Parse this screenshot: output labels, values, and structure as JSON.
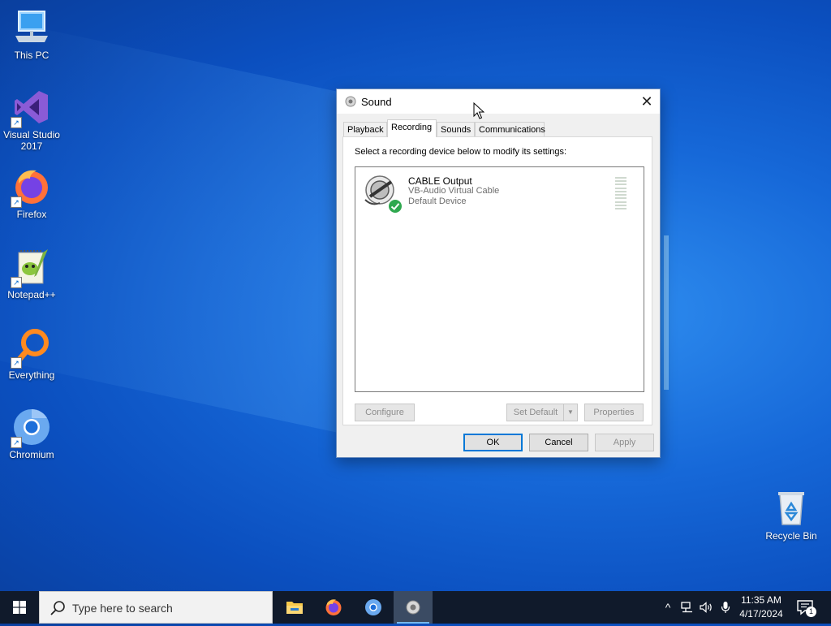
{
  "desktop": {
    "icons": [
      {
        "label": "This PC",
        "icon": "computer-icon"
      },
      {
        "label": "Visual Studio 2017",
        "icon": "visual-studio-icon"
      },
      {
        "label": "Firefox",
        "icon": "firefox-icon"
      },
      {
        "label": "Notepad++",
        "icon": "notepad-plus-plus-icon"
      },
      {
        "label": "Everything",
        "icon": "everything-search-icon"
      },
      {
        "label": "Chromium",
        "icon": "chromium-icon"
      },
      {
        "label": "Recycle Bin",
        "icon": "recycle-bin-icon"
      }
    ]
  },
  "dialog": {
    "title": "Sound",
    "close_glyph": "✕",
    "tabs": [
      {
        "label": "Playback",
        "active": false
      },
      {
        "label": "Recording",
        "active": true
      },
      {
        "label": "Sounds",
        "active": false
      },
      {
        "label": "Communications",
        "active": false
      }
    ],
    "instruction": "Select a recording device below to modify its settings:",
    "devices": [
      {
        "name": "CABLE Output",
        "description": "VB-Audio Virtual Cable",
        "status": "Default Device",
        "icon": "microphone-cable-icon",
        "badge": "default-check-icon"
      }
    ],
    "buttons": {
      "configure": "Configure",
      "set_default": "Set Default",
      "set_default_arrow": "▼",
      "properties": "Properties",
      "ok": "OK",
      "cancel": "Cancel",
      "apply": "Apply"
    }
  },
  "taskbar": {
    "search_placeholder": "Type here to search",
    "apps": [
      {
        "name": "File Explorer",
        "icon": "folder-icon",
        "state": "normal"
      },
      {
        "name": "Firefox",
        "icon": "firefox-icon",
        "state": "normal"
      },
      {
        "name": "Chromium",
        "icon": "chromium-icon",
        "state": "normal"
      },
      {
        "name": "Sound",
        "icon": "speaker-icon",
        "state": "active"
      }
    ],
    "tray": {
      "chevron": "^",
      "time": "11:35 AM",
      "date": "4/17/2024",
      "notification_count": "1"
    }
  },
  "colors": {
    "accent": "#0078d7",
    "check_green": "#2fa84f",
    "taskbar": "#101a2b"
  }
}
